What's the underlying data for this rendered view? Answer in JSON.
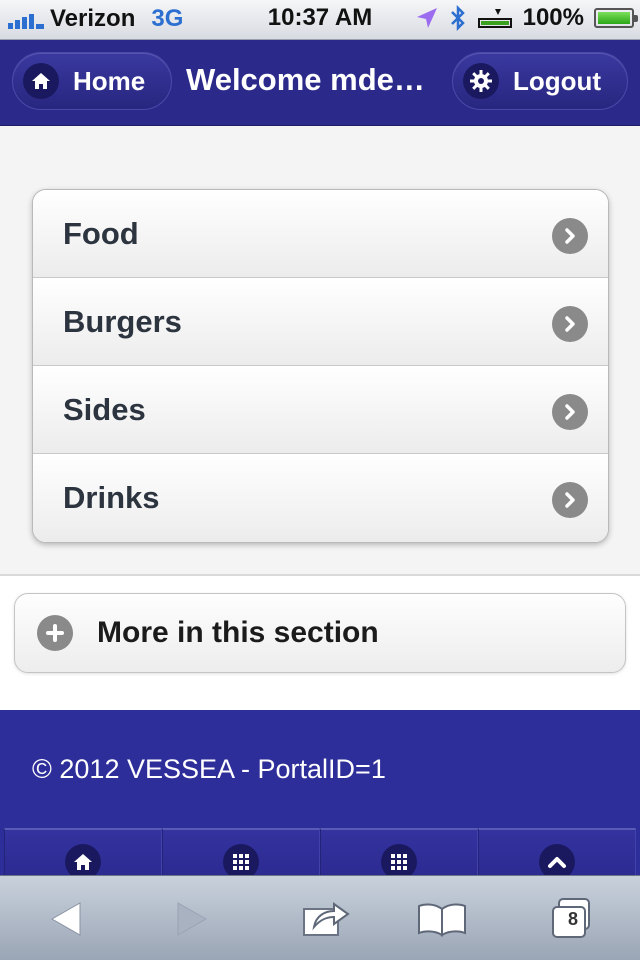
{
  "status_bar": {
    "carrier": "Verizon",
    "network": "3G",
    "time": "10:37 AM",
    "battery": "100%"
  },
  "header": {
    "home_label": "Home",
    "title": "Welcome mde…",
    "logout_label": "Logout"
  },
  "menu": {
    "items": [
      {
        "label": "Food"
      },
      {
        "label": "Burgers"
      },
      {
        "label": "Sides"
      },
      {
        "label": "Drinks"
      }
    ]
  },
  "more": {
    "label": "More in this section"
  },
  "footer": {
    "copyright": "© 2012 VESSEA - PortalID=1",
    "nav_icons": [
      "home-icon",
      "grid-icon",
      "grid-icon",
      "chevron-up-icon"
    ]
  },
  "safari": {
    "tab_count": "8"
  },
  "colors": {
    "header_bg": "#2b2a8b",
    "footer_bg": "#2e2e9a",
    "content_bg": "#f4f4f4",
    "text_dark": "#2c3440"
  }
}
